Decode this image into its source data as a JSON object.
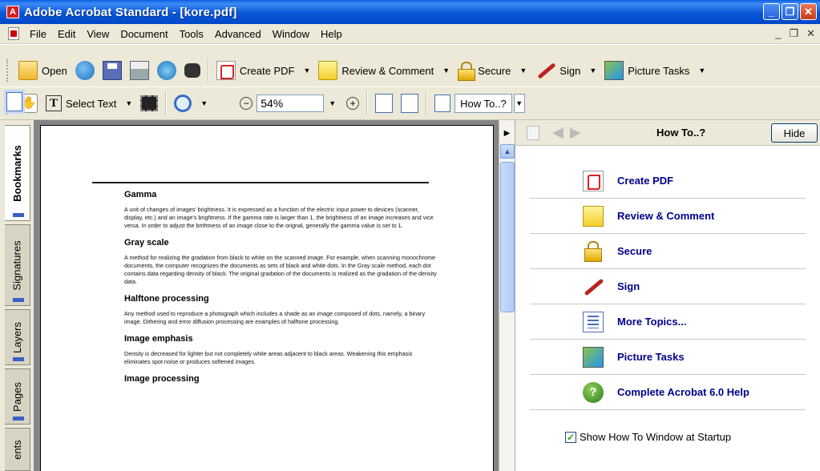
{
  "window": {
    "title": "Adobe Acrobat Standard - [kore.pdf]",
    "controls": {
      "minimize": "_",
      "restore": "❐",
      "close": "✕"
    }
  },
  "menu": {
    "items": [
      "File",
      "Edit",
      "View",
      "Document",
      "Tools",
      "Advanced",
      "Window",
      "Help"
    ],
    "mdi_controls": [
      "_",
      "❐",
      "✕"
    ]
  },
  "toolbar1": {
    "open": "Open",
    "create_pdf": "Create PDF",
    "review_comment": "Review & Comment",
    "secure": "Secure",
    "sign": "Sign",
    "picture_tasks": "Picture Tasks",
    "dropdown_caret": "▼"
  },
  "toolbar2": {
    "select_text": "Select Text",
    "zoom_out": "−",
    "zoom_value": "54%",
    "zoom_in": "+",
    "how_to": "How To..?",
    "dropdown_caret": "▼"
  },
  "nav_tabs": [
    "Bookmarks",
    "Signatures",
    "Layers",
    "Pages",
    "ents"
  ],
  "document": {
    "sections": [
      {
        "heading": "Gamma",
        "body": "A unit of changes of images' brightness. It is expressed as a function of the electric input power to devices (scanner, display, etc.) and an image's brightness. If the gamma rate is larger than 1, the brightness of an image increases and vice versa. In order to adjust the brithtness of an image close to the orignal, generally the gamma value is set to 1."
      },
      {
        "heading": "Gray scale",
        "body": "A method for realizing the gradation from black to white on the scanned image. For example, when scanning monochrome documents, the computer recognizes the documents as sets of black and white dots. In the Gray scale method, each dot contains data regarding density of black. The original gradation of the documents is realized as the gradation of the density data."
      },
      {
        "heading": "Halftone processing",
        "body": "Any method used to reproduce a photograph which includes a shade as an image composed of dots, namely, a binary image. Dithering and error diffusion processing are examples of halftone processing."
      },
      {
        "heading": "Image emphasis",
        "body": "Density is decreased for lighter but not completely white areas adjacent to black areas. Weakening this emphasis eliminates spot noise or produces softened images."
      },
      {
        "heading": "Image processing",
        "body": ""
      }
    ]
  },
  "howto_panel": {
    "title": "How To..?",
    "hide_label": "Hide",
    "topics": [
      {
        "label": "Create PDF",
        "icon": "create-pdf-icon"
      },
      {
        "label": "Review & Comment",
        "icon": "review-comment-icon"
      },
      {
        "label": "Secure",
        "icon": "lock-icon"
      },
      {
        "label": "Sign",
        "icon": "pen-icon"
      },
      {
        "label": "More Topics...",
        "icon": "list-icon"
      },
      {
        "label": "Picture Tasks",
        "icon": "picture-tasks-icon"
      },
      {
        "label": "Complete Acrobat 6.0 Help",
        "icon": "help-icon"
      }
    ],
    "startup_label": "Show How To Window at Startup",
    "startup_checked": true
  }
}
